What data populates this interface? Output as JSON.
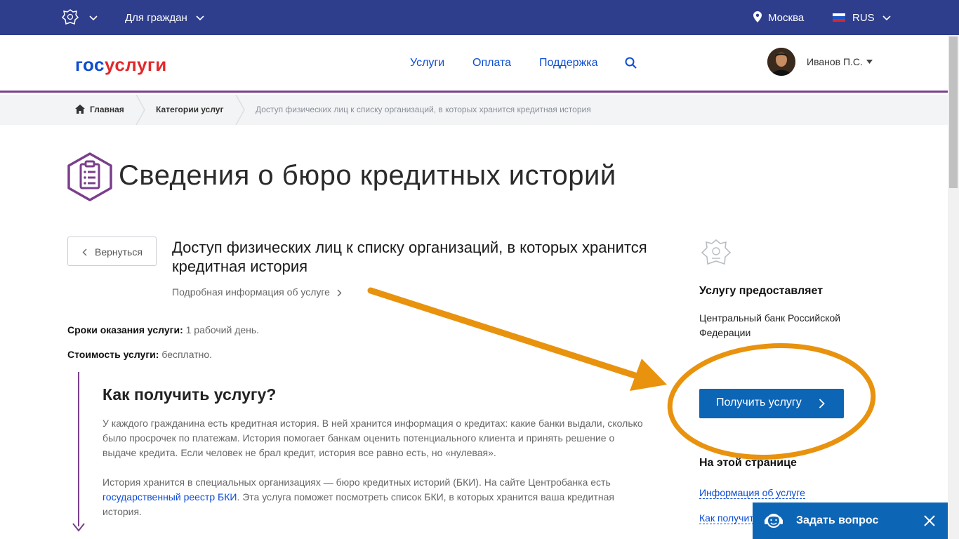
{
  "topbar": {
    "audience_label": "Для граждан",
    "city": "Москва",
    "language": "RUS"
  },
  "header": {
    "logo_part1": "гос",
    "logo_part2": "услуги",
    "nav": [
      "Услуги",
      "Оплата",
      "Поддержка"
    ],
    "user_name": "Иванов П.С."
  },
  "breadcrumb": {
    "home": "Главная",
    "categories": "Категории услуг",
    "current": "Доступ физических лиц к списку организаций, в которых хранится кредитная история"
  },
  "page": {
    "title": "Сведения о бюро кредитных историй",
    "back_label": "Вернуться",
    "service_name": "Доступ физических лиц к списку организаций, в которых хранится кредитная история",
    "more_info_link": "Подробная информация об услуге",
    "term_label": "Сроки оказания услуги:",
    "term_value": "1 рабочий день.",
    "cost_label": "Стоимость услуги:",
    "cost_value": "бесплатно.",
    "how_heading": "Как получить услугу?",
    "para1": "У каждого гражданина есть кредитная история. В ней хранится информация о кредитах: какие банки выдали, сколько было просрочек по платежам. История помогает банкам оценить потенциального клиента и принять решение о выдаче кредита. Если человек не брал кредит, история все равно есть, но «нулевая».",
    "para2_before": "История хранится в специальных организациях — бюро кредитных историй (БКИ). На сайте Центробанка есть ",
    "para2_link": "государственный реестр БКИ",
    "para2_after": ". Эта услуга поможет посмотреть список БКИ, в которых хранится ваша кредитная история."
  },
  "sidebar": {
    "provider_heading": "Услугу предоставляет",
    "provider_name": "Центральный банк Российской Федерации",
    "get_service_button": "Получить услугу",
    "on_page_heading": "На этой странице",
    "links": [
      "Информация об услуге",
      "Как получит"
    ]
  },
  "ask_widget": {
    "label": "Задать вопрос"
  },
  "colors": {
    "topbar": "#2e3d8c",
    "accent_purple": "#7a3f8c",
    "link_blue": "#0d4cd3",
    "button_blue": "#0d65b6",
    "annotation_orange": "#e8920e"
  }
}
